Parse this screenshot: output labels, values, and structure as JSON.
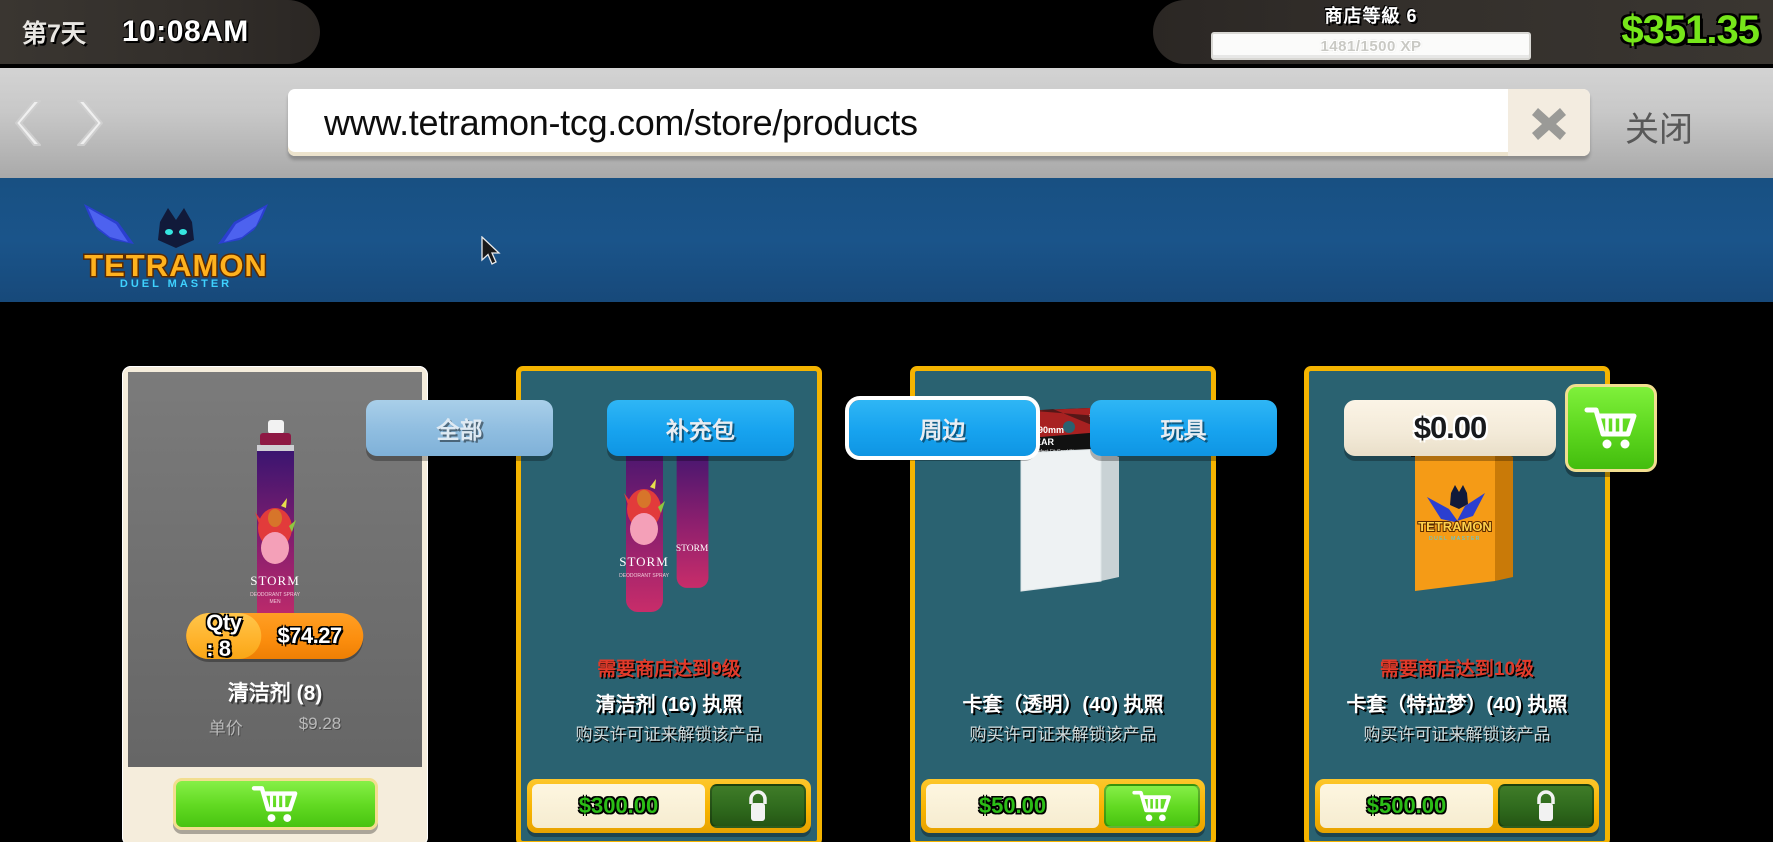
{
  "hud": {
    "day_label": "第7天",
    "time": "10:08AM",
    "store_level_label": "商店等級 6",
    "xp_text": "1481/1500 XP",
    "xp_current": 1481,
    "xp_max": 1500,
    "money": "$351.35",
    "money_color": "#76e61a"
  },
  "browser": {
    "back_icon": "chevron-left-icon",
    "forward_icon": "chevron-right-icon",
    "url": "www.tetramon-tcg.com/store/products",
    "url_placeholder": "www.tetramon-tcg.com/store/products",
    "clear_icon": "close-x-icon",
    "close_label": "关闭"
  },
  "site": {
    "logo_title": "TETRAMON",
    "logo_subtitle": "DUEL MASTER",
    "tabs": [
      {
        "label": "全部",
        "state": "active"
      },
      {
        "label": "补充包",
        "state": "normal"
      },
      {
        "label": "周边",
        "state": "hover"
      },
      {
        "label": "玩具",
        "state": "normal"
      }
    ],
    "cart_total": "$0.00",
    "cart_icon": "shopping-cart-icon"
  },
  "products": [
    {
      "kind": "owned",
      "qty_label": "Qty : 8",
      "total_price": "$74.27",
      "name": "清洁剂 (8)",
      "unit_label": "单价",
      "unit_price": "$9.28",
      "action_icon": "shopping-cart-icon",
      "art": "spray-can"
    },
    {
      "kind": "locked",
      "requirement": "需要商店达到9级",
      "name": "清洁剂 (16) 执照",
      "subtitle": "购买许可证来解锁该产品",
      "price": "$300.00",
      "action_icon": "lock-icon",
      "art": "spray-can-double"
    },
    {
      "kind": "locked",
      "requirement": "",
      "name": "卡套（透明）(40) 执照",
      "subtitle": "购买许可证来解锁该产品",
      "price": "$50.00",
      "action_icon": "shopping-cart-icon",
      "art": "sleeve-clear"
    },
    {
      "kind": "locked",
      "requirement": "需要商店达到10级",
      "name": "卡套（特拉梦）(40) 执照",
      "subtitle": "购买许可证来解锁该产品",
      "price": "$500.00",
      "action_icon": "lock-icon",
      "art": "sleeve-tetramon"
    }
  ],
  "colors": {
    "nav_blue": "#1a548a",
    "tab_blue": "#17a3ef",
    "card_teal": "#2a6271",
    "card_gold": "#f5b400",
    "green": "#62da22",
    "money_green": "#2bbd16",
    "req_red": "#e03a2a"
  }
}
